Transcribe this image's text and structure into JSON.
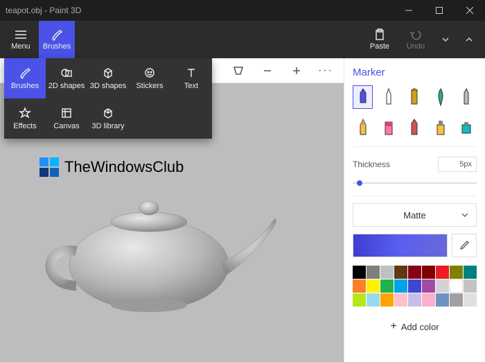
{
  "title": "teapot.obj - Paint 3D",
  "ribbon": {
    "menu": "Menu",
    "brushes": "Brushes",
    "paste": "Paste",
    "undo": "Undo"
  },
  "dropdown": {
    "brushes": "Brushes",
    "shapes2d": "2D shapes",
    "shapes3d": "3D shapes",
    "stickers": "Stickers",
    "text": "Text",
    "effects": "Effects",
    "canvas": "Canvas",
    "library3d": "3D library"
  },
  "watermark": "TheWindowsClub",
  "panel": {
    "heading": "Marker",
    "thickness_label": "Thickness",
    "thickness_value": "5px",
    "finish": "Matte",
    "add_color": "Add color"
  },
  "palette": {
    "row1": [
      "#000000",
      "#7f7f7f",
      "#c0c0c0",
      "#603913",
      "#880015",
      "#800000",
      "#ed1c24",
      "#808000",
      "#008080"
    ],
    "row2": [
      "#ff7f27",
      "#fff200",
      "#22b14c",
      "#00a2e8",
      "#3f48cc",
      "#a349a4",
      "#d3d3d3",
      "#ffffff",
      "#c3c3c3"
    ],
    "row3": [
      "#b5e61d",
      "#99d9ea",
      "#ffa500",
      "#ffc0cb",
      "#c8bfe7",
      "#ffaec9",
      "#7092be",
      "#a0a0a0",
      "#e0e0e0"
    ]
  },
  "colors": {
    "accent": "#4a52e8"
  }
}
